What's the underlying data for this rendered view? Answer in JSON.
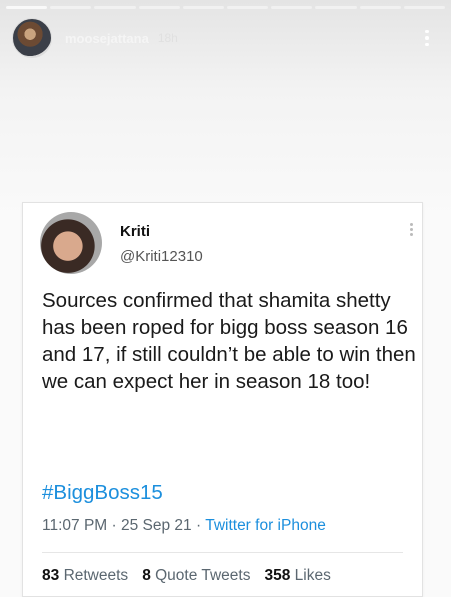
{
  "story": {
    "username": "moosejattana",
    "time": "18h",
    "progress_segments": 10,
    "completed_segments": 1
  },
  "tweet": {
    "name": "Kriti",
    "handle": "@Kriti12310",
    "text": "Sources confirmed that shamita shetty has been roped for bigg boss season 16 and 17, if still couldn’t be able to win then we can expect her in season 18 too!",
    "hashtag": "#BiggBoss15",
    "time": "11:07 PM",
    "date": "25 Sep 21",
    "source": "Twitter for iPhone",
    "separator": "·",
    "retweets": {
      "count": "83",
      "label": "Retweets"
    },
    "quote_tweets": {
      "count": "8",
      "label": "Quote Tweets"
    },
    "likes": {
      "count": "358",
      "label": "Likes"
    }
  },
  "colors": {
    "link": "#1c8fdd",
    "muted": "#5b6770"
  },
  "icons": {
    "story_menu": "vertical-ellipsis-icon",
    "tweet_menu": "vertical-ellipsis-icon"
  }
}
